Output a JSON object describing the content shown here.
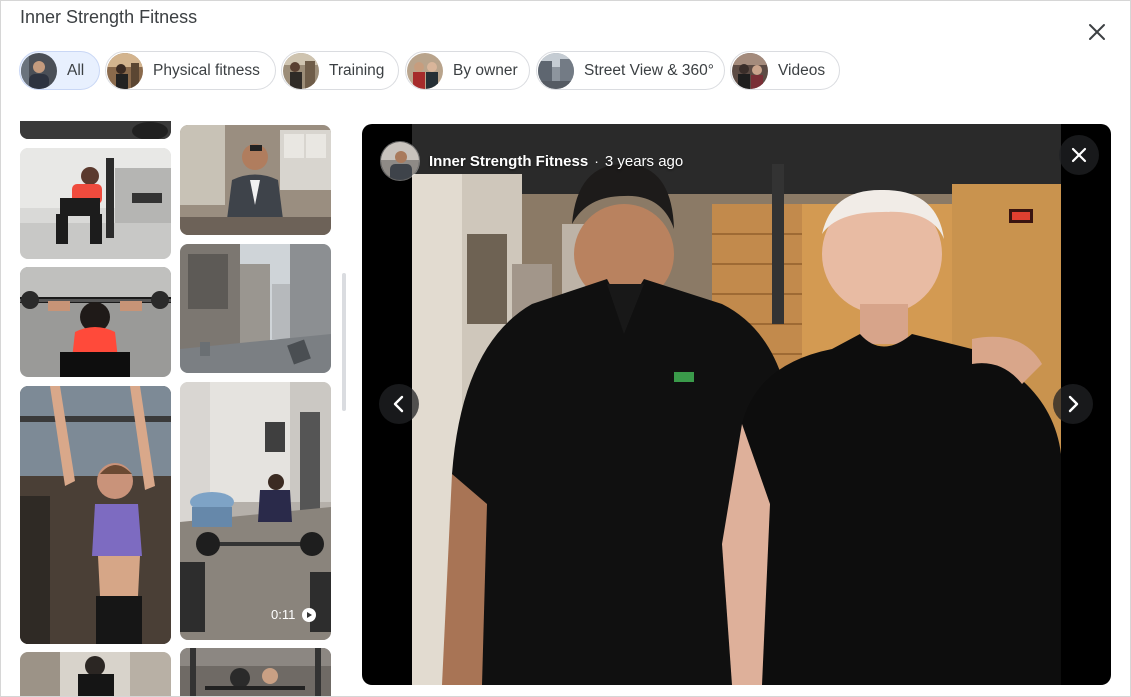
{
  "header": {
    "title": "Inner Strength Fitness",
    "close_icon": "close-icon"
  },
  "chips": [
    {
      "label": "All",
      "active": true
    },
    {
      "label": "Physical fitness",
      "active": false
    },
    {
      "label": "Training",
      "active": false
    },
    {
      "label": "By owner",
      "active": false
    },
    {
      "label": "Street View & 360°",
      "active": false
    },
    {
      "label": "Videos",
      "active": false
    }
  ],
  "grid": {
    "video_duration": "0:11",
    "play_icon": "play-icon"
  },
  "viewer": {
    "owner_name": "Inner Strength Fitness",
    "separator": "·",
    "age": "3 years ago",
    "close_icon": "close-icon",
    "prev_icon": "chevron-left-icon",
    "next_icon": "chevron-right-icon"
  },
  "colors": {
    "chip_active_bg": "#e8f0fe",
    "chip_border": "#dadce0",
    "text": "#3c4043",
    "viewer_bg": "#000000"
  }
}
